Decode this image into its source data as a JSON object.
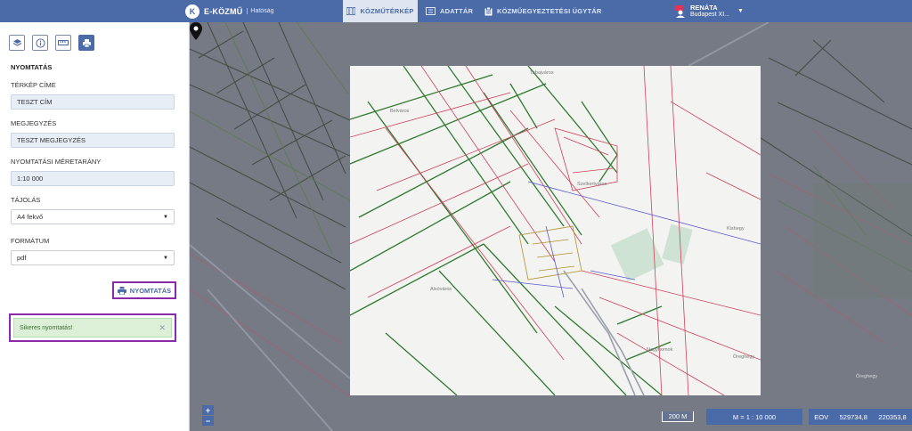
{
  "app": {
    "logo_letter": "K",
    "name": "E-KÖZMŰ",
    "subtitle": "Hatóság"
  },
  "nav": {
    "map": "KÖZMŰTÉRKÉP",
    "data": "ADATTÁR",
    "admin": "KÖZMŰEGYEZTETÉSI ÜGYTÁR"
  },
  "user": {
    "badge": "14",
    "name": "RENÁTA",
    "city": "Budapest XI..."
  },
  "sidebar": {
    "section_title": "NYOMTATÁS",
    "map_title_label": "TÉRKÉP CÍME",
    "map_title_value": "TESZT CÍM",
    "note_label": "MEGJEGYZÉS",
    "note_value": "TESZT MEGJEGYZÉS",
    "scale_label": "NYOMTATÁSI MÉRETARÁNY",
    "scale_value": "1:10 000",
    "orientation_label": "TÁJOLÁS",
    "orientation_value": "A4 fekvő",
    "format_label": "FORMÁTUM",
    "format_value": "pdf",
    "print_button": "NYOMTATÁS",
    "alert_text": "Sikeres nyomtatás!"
  },
  "map": {
    "places": [
      "Belváros",
      "Tabajváros",
      "Szelkertváros",
      "Kishegy",
      "Alsóváros",
      "Nagyhomok",
      "Öreghegy",
      "Öreghegy"
    ],
    "scalebar": "200 M",
    "ratio": "M = 1 : 10 000",
    "coord_label": "EOV",
    "coord_x": "529734,8",
    "coord_y": "220353,8"
  },
  "colors": {
    "topbar": "#4a6aa8",
    "alert_border": "#8a2aa8",
    "alert_bg": "#dbf0d6"
  }
}
